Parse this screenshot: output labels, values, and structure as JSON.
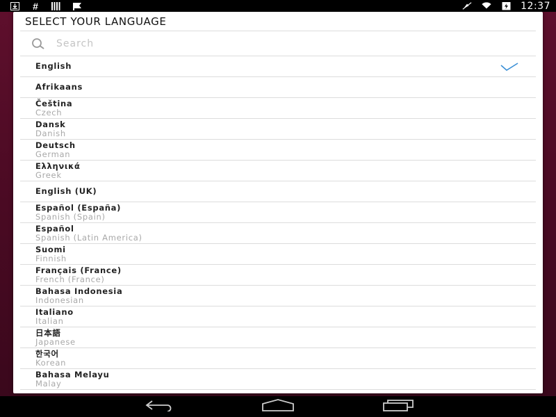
{
  "status_bar": {
    "time": "12:37",
    "left_icons": [
      "download-icon",
      "hash-icon",
      "barcode-icon",
      "flag-icon"
    ],
    "right_icons": [
      "mute-icon",
      "wifi-icon",
      "battery-icon"
    ]
  },
  "dialog": {
    "title": "SELECT YOUR LANGUAGE",
    "search": {
      "placeholder": "Search",
      "value": ""
    },
    "accent_color": "#3a8fd6",
    "languages": [
      {
        "name": "English",
        "sub": "",
        "selected": true
      },
      {
        "name": "Afrikaans",
        "sub": ""
      },
      {
        "name": "Čeština",
        "sub": "Czech"
      },
      {
        "name": "Dansk",
        "sub": "Danish"
      },
      {
        "name": "Deutsch",
        "sub": "German"
      },
      {
        "name": "Ελληνικά",
        "sub": "Greek"
      },
      {
        "name": "English (UK)",
        "sub": ""
      },
      {
        "name": "Español (España)",
        "sub": "Spanish (Spain)"
      },
      {
        "name": "Español",
        "sub": "Spanish (Latin America)"
      },
      {
        "name": "Suomi",
        "sub": "Finnish"
      },
      {
        "name": "Français (France)",
        "sub": "French (France)"
      },
      {
        "name": "Bahasa Indonesia",
        "sub": "Indonesian"
      },
      {
        "name": "Italiano",
        "sub": "Italian"
      },
      {
        "name": "日本語",
        "sub": "Japanese"
      },
      {
        "name": "한국어",
        "sub": "Korean"
      },
      {
        "name": "Bahasa Melayu",
        "sub": "Malay"
      }
    ]
  },
  "nav_bar": {
    "buttons": [
      "back-icon",
      "home-icon",
      "recents-icon"
    ]
  }
}
